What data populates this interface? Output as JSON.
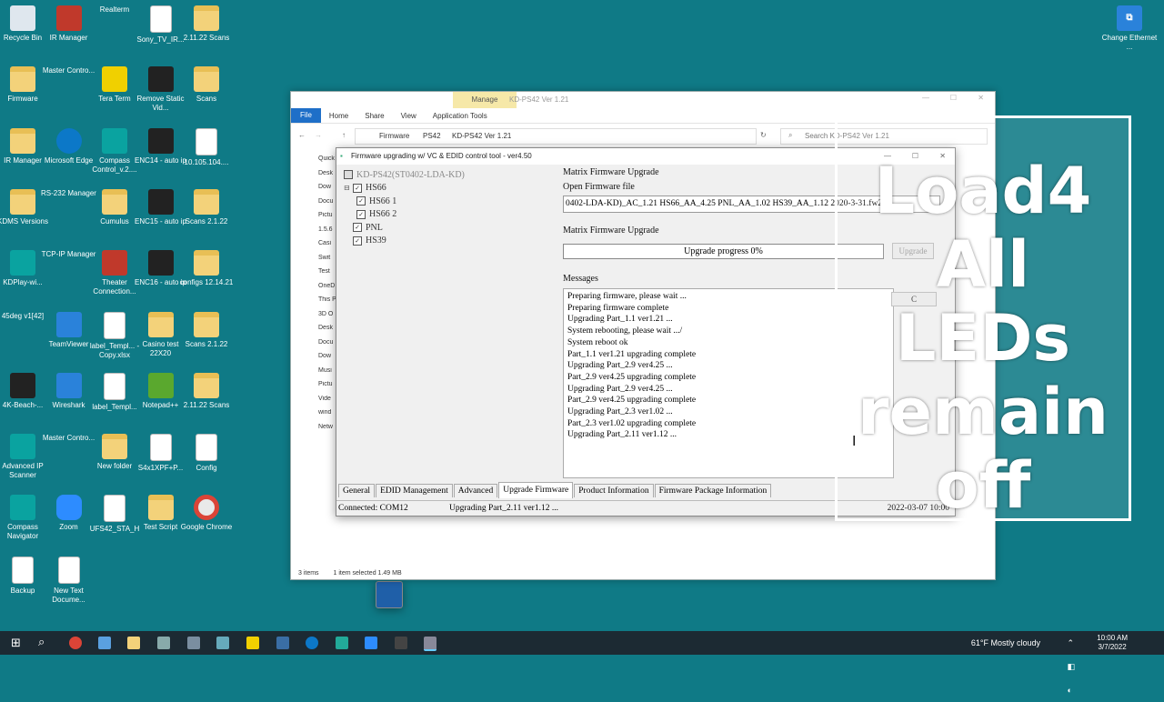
{
  "desktop": {
    "icons": [
      {
        "label": "Recycle Bin",
        "icon": "recycle-bin-icon"
      },
      {
        "label": "IR Manager",
        "icon": "ir-manager-icon"
      },
      {
        "label": "Realterm",
        "icon": "realterm-icon"
      },
      {
        "label": "Sony_TV_IR...",
        "icon": "document-icon"
      },
      {
        "label": "2.11.22 Scans",
        "icon": "folder-icon"
      },
      {
        "label": "Firmware",
        "icon": "folder-icon"
      },
      {
        "label": "Master Contro...",
        "icon": "master-control-icon"
      },
      {
        "label": "Tera Term",
        "icon": "teraterm-icon"
      },
      {
        "label": "Remove Static Vid...",
        "icon": "video-icon"
      },
      {
        "label": "Scans",
        "icon": "folder-icon"
      },
      {
        "label": "IR Manager",
        "icon": "folder-icon"
      },
      {
        "label": "Microsoft Edge",
        "icon": "edge-icon"
      },
      {
        "label": "Compass Control_v.2....",
        "icon": "compass-icon"
      },
      {
        "label": "ENC14 - auto ip",
        "icon": "video-icon"
      },
      {
        "label": "10.105.104....",
        "icon": "document-icon"
      },
      {
        "label": "KDMS Versions",
        "icon": "folder-icon"
      },
      {
        "label": "RS-232 Manager",
        "icon": "rs232-icon"
      },
      {
        "label": "Cumulus",
        "icon": "folder-icon"
      },
      {
        "label": "ENC15 - auto ip",
        "icon": "video-icon"
      },
      {
        "label": "Scans 2.1.22",
        "icon": "folder-icon"
      },
      {
        "label": "KDPlay-wi...",
        "icon": "kdplay-icon"
      },
      {
        "label": "TCP-IP Manager",
        "icon": "tcpip-icon"
      },
      {
        "label": "Theater Connection...",
        "icon": "pdf-icon"
      },
      {
        "label": "ENC16 - auto ip",
        "icon": "video-icon"
      },
      {
        "label": "configs 12.14.21",
        "icon": "folder-icon"
      },
      {
        "label": "45deg v1[42]",
        "icon": "image-icon"
      },
      {
        "label": "TeamViewer",
        "icon": "teamviewer-icon"
      },
      {
        "label": "label_Templ... - Copy.xlsx",
        "icon": "document-icon"
      },
      {
        "label": "Casino test 22X20",
        "icon": "folder-icon"
      },
      {
        "label": "Scans 2.1.22",
        "icon": "folder-icon"
      },
      {
        "label": "4K-Beach-...",
        "icon": "video-icon"
      },
      {
        "label": "Wireshark",
        "icon": "wireshark-icon"
      },
      {
        "label": "label_Templ...",
        "icon": "document-icon"
      },
      {
        "label": "Notepad++",
        "icon": "notepad-icon"
      },
      {
        "label": "2.11.22 Scans",
        "icon": "folder-icon"
      },
      {
        "label": "Advanced IP Scanner",
        "icon": "ip-scanner-icon"
      },
      {
        "label": "Master Contro...",
        "icon": "master-control-icon"
      },
      {
        "label": "New folder",
        "icon": "folder-icon"
      },
      {
        "label": "S4x1XPF+P...",
        "icon": "document-icon"
      },
      {
        "label": "Config",
        "icon": "document-icon"
      },
      {
        "label": "Compass Navigator",
        "icon": "compass-icon"
      },
      {
        "label": "Zoom",
        "icon": "zoom-icon"
      },
      {
        "label": "UFS42_STA_H",
        "icon": "document-icon"
      },
      {
        "label": "Test Script",
        "icon": "folder-icon"
      },
      {
        "label": "Google Chrome",
        "icon": "chrome-icon"
      },
      {
        "label": "Backup",
        "icon": "document-icon"
      },
      {
        "label": "New Text Docume...",
        "icon": "document-icon"
      }
    ],
    "right_icon": {
      "label": "Change Ethernet ...",
      "icon": "network-icon"
    }
  },
  "explorer": {
    "title": "KD-PS42 Ver 1.21",
    "manage_tab": "Manage",
    "ribbon_tabs": [
      "File",
      "Home",
      "Share",
      "View",
      "Application Tools"
    ],
    "breadcrumb": [
      "Firmware",
      "PS42",
      "KD-PS42 Ver 1.21"
    ],
    "search_placeholder": "Search KD-PS42 Ver 1.21",
    "sidebar": [
      "Quick",
      "Desk",
      "Dow",
      "Docu",
      "Pictu",
      "1.5.6",
      "Casi",
      "Swit",
      "Test",
      "OneD",
      "This P",
      "3D O",
      "Desk",
      "Docu",
      "Dow",
      "Musi",
      "Pictu",
      "Vide",
      "wind",
      "Netw"
    ],
    "status_items": "3 items",
    "status_selected": "1 item selected  1.49 MB"
  },
  "app": {
    "title": "Firmware upgrading w/ VC & EDID control tool - ver4.50",
    "tree": {
      "root": "KD-PS42(ST0402-LDA-KD)",
      "items": [
        "HS66",
        "HS66 1",
        "HS66 2",
        "PNL",
        "HS39"
      ]
    },
    "section1": "Matrix Firmware Upgrade",
    "open_file_label": "Open Firmware file",
    "firmware_file": "0402-LDA-KD)_AC_1.21 HS66_AA_4.25 PNL_AA_1.02 HS39_AA_1.12 2020-3-31.fw2",
    "section2": "Matrix Firmware Upgrade",
    "progress_text": "Upgrade progress 0%",
    "progress_value": 0,
    "upgrade_button": "Upgrade",
    "messages_label": "Messages",
    "messages": [
      "Preparing firmware, please wait ...",
      "Preparing firmware complete",
      "Upgrading Part_1.1 ver1.21 ...",
      "System rebooting, please wait .../",
      "System reboot ok",
      "Part_1.1 ver1.21 upgrading complete",
      "Upgrading Part_2.9 ver4.25 ...",
      "Part_2.9 ver4.25 upgrading complete",
      "Upgrading Part_2.9 ver4.25 ...",
      "Part_2.9 ver4.25 upgrading complete",
      "Upgrading Part_2.3 ver1.02 ...",
      "Part_2.3 ver1.02 upgrading complete",
      "Upgrading Part_2.11 ver1.12 ..."
    ],
    "clear_button": "C",
    "tabs": [
      "General",
      "EDID Management",
      "Advanced",
      "Upgrade Firmware",
      "Product Information",
      "Firmware Package Information"
    ],
    "active_tab": "Upgrade Firmware",
    "status_connected": "Connected: COM12",
    "status_task": "Upgrading Part_2.11 ver1.12 ...",
    "status_date": "2022-03-07 10:00"
  },
  "overlay": {
    "lines": [
      "Load4",
      "All",
      "LEDs",
      "remain",
      "off"
    ]
  },
  "taskbar": {
    "weather": "61°F  Mostly cloudy",
    "time": "10:00 AM",
    "date": "3/7/2022"
  }
}
